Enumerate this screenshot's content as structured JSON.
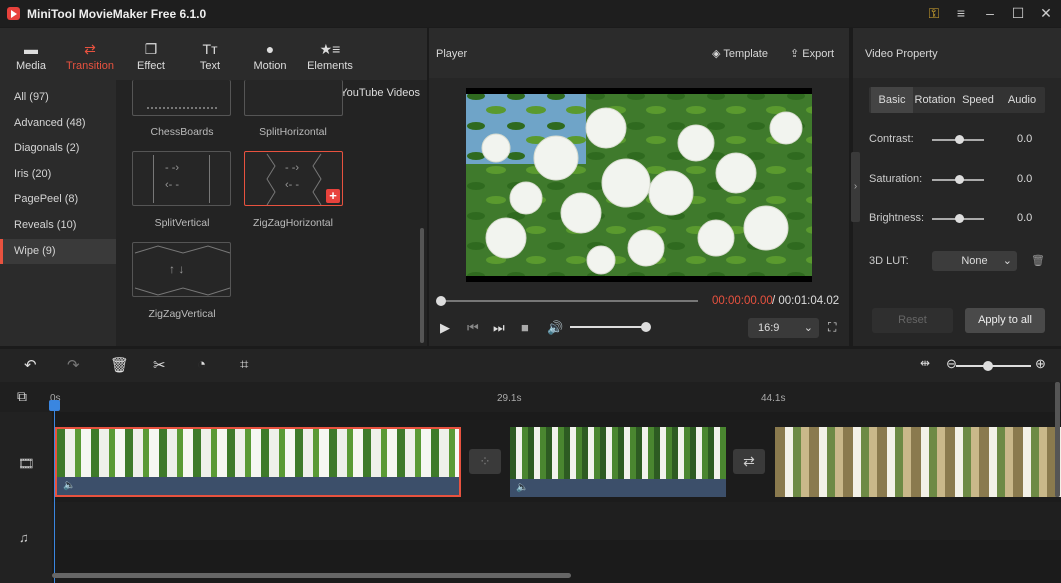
{
  "app": {
    "title": "MiniTool MovieMaker Free 6.1.0"
  },
  "toolbar": {
    "tabs": [
      {
        "label": "Media",
        "icon": "folder-icon"
      },
      {
        "label": "Transition",
        "icon": "transition-arrows-icon",
        "active": true
      },
      {
        "label": "Effect",
        "icon": "effect-icon"
      },
      {
        "label": "Text",
        "icon": "text-icon"
      },
      {
        "label": "Motion",
        "icon": "motion-icon"
      },
      {
        "label": "Elements",
        "icon": "elements-icon"
      }
    ]
  },
  "categories": [
    {
      "label": "All (97)"
    },
    {
      "label": "Advanced (48)"
    },
    {
      "label": "Diagonals (2)"
    },
    {
      "label": "Iris (20)"
    },
    {
      "label": "PagePeel (8)"
    },
    {
      "label": "Reveals (10)"
    },
    {
      "label": "Wipe (9)",
      "active": true
    }
  ],
  "transitions": {
    "download_link": "Download YouTube Videos",
    "items": [
      {
        "label": "ChessBoards"
      },
      {
        "label": "SplitHorizontal"
      },
      {
        "label": "SplitVertical"
      },
      {
        "label": "ZigZagHorizontal",
        "selected": true
      },
      {
        "label": "ZigZagVertical"
      }
    ]
  },
  "player": {
    "title": "Player",
    "template_label": "Template",
    "export_label": "Export",
    "current_time": "00:00:00.00",
    "total_time": " / 00:01:04.02",
    "aspect_ratio": "16:9",
    "progress": 0.0,
    "volume": 1.0
  },
  "properties": {
    "title": "Video Property",
    "tabs": [
      "Basic",
      "Rotation",
      "Speed",
      "Audio"
    ],
    "active_tab": "Basic",
    "contrast": {
      "label": "Contrast:",
      "value": "0.0"
    },
    "saturation": {
      "label": "Saturation:",
      "value": "0.0"
    },
    "brightness": {
      "label": "Brightness:",
      "value": "0.0"
    },
    "lut": {
      "label": "3D LUT:",
      "value": "None"
    },
    "reset_label": "Reset",
    "apply_label": "Apply to all"
  },
  "timeline": {
    "ruler": [
      "0s",
      "29.1s",
      "44.1s"
    ],
    "colors": {
      "playhead": "#3a86e0",
      "accent": "#e8523f"
    }
  }
}
